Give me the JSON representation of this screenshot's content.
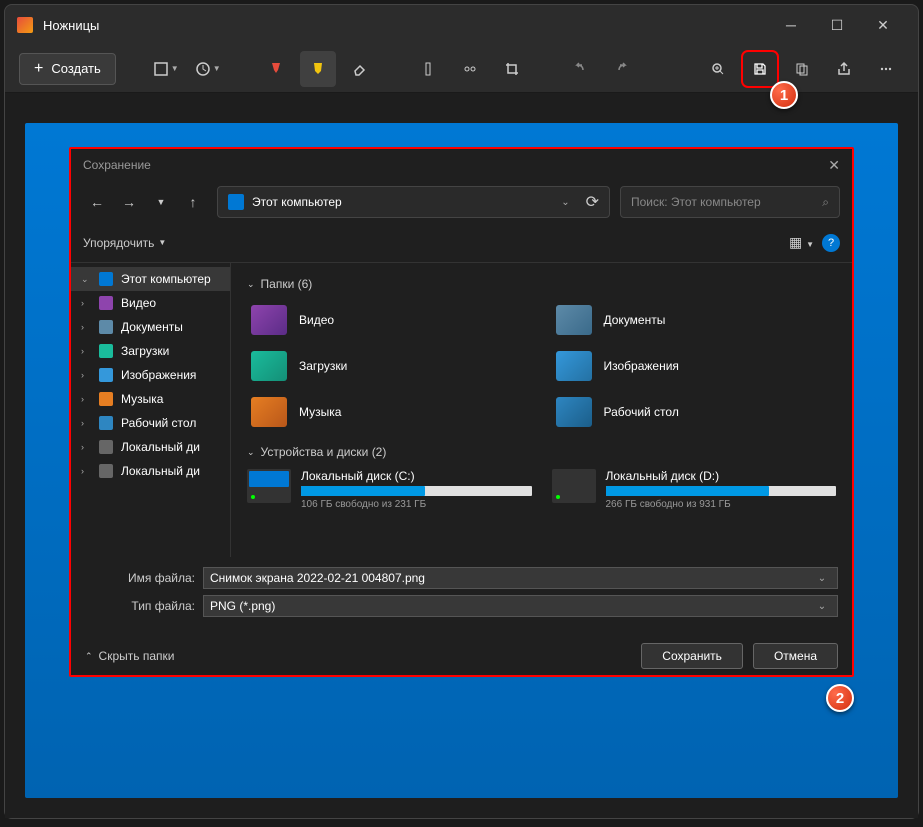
{
  "app": {
    "title": "Ножницы"
  },
  "toolbar": {
    "new_label": "Создать"
  },
  "dialog": {
    "title": "Сохранение",
    "breadcrumb": "Этот компьютер",
    "search_placeholder": "Поиск: Этот компьютер",
    "organize": "Упорядочить",
    "folders_header": "Папки (6)",
    "drives_header": "Устройства и диски (2)",
    "filename_label": "Имя файла:",
    "filename_value": "Снимок экрана 2022-02-21 004807.png",
    "filetype_label": "Тип файла:",
    "filetype_value": "PNG (*.png)",
    "hide_folders": "Скрыть папки",
    "save_btn": "Сохранить",
    "cancel_btn": "Отмена"
  },
  "sidebar": {
    "items": [
      {
        "label": "Этот компьютер",
        "expanded": true,
        "active": true,
        "icon": "#0078d4"
      },
      {
        "label": "Видео",
        "icon": "#8e44ad"
      },
      {
        "label": "Документы",
        "icon": "#5d8aa8"
      },
      {
        "label": "Загрузки",
        "icon": "#1abc9c"
      },
      {
        "label": "Изображения",
        "icon": "#3498db"
      },
      {
        "label": "Музыка",
        "icon": "#e67e22"
      },
      {
        "label": "Рабочий стол",
        "icon": "#2e86c1"
      },
      {
        "label": "Локальный ди",
        "icon": "#666"
      },
      {
        "label": "Локальный ди",
        "icon": "#666"
      }
    ]
  },
  "folders": [
    {
      "label": "Видео",
      "cls": "ic-video"
    },
    {
      "label": "Документы",
      "cls": "ic-docs"
    },
    {
      "label": "Загрузки",
      "cls": "ic-dl"
    },
    {
      "label": "Изображения",
      "cls": "ic-img"
    },
    {
      "label": "Музыка",
      "cls": "ic-music"
    },
    {
      "label": "Рабочий стол",
      "cls": "ic-desk"
    }
  ],
  "drives": [
    {
      "name": "Локальный диск (C:)",
      "free": "106 ГБ свободно из 231 ГБ",
      "pct": 54,
      "win": true
    },
    {
      "name": "Локальный диск (D:)",
      "free": "266 ГБ свободно из 931 ГБ",
      "pct": 71
    }
  ],
  "badges": {
    "one": "1",
    "two": "2"
  }
}
